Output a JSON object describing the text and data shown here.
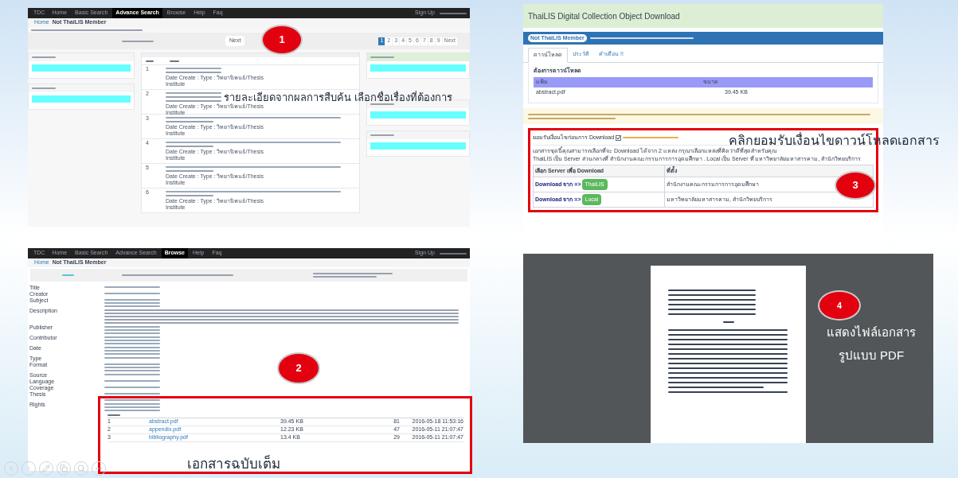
{
  "search_results": {
    "nav": {
      "brand": "TDC",
      "items": [
        {
          "label": "Home",
          "selected": false
        },
        {
          "label": "Basic Search",
          "selected": false
        },
        {
          "label": "Advance Search",
          "selected": true
        },
        {
          "label": "Browse",
          "selected": false
        },
        {
          "label": "Help",
          "selected": false
        },
        {
          "label": "Faq",
          "selected": false
        }
      ],
      "sign_up": "Sign Up"
    },
    "breadcrumb": [
      "Home",
      "Not ThaiLIS Member"
    ],
    "next_button": "Next",
    "pagination": [
      {
        "label": "1",
        "selected": true
      },
      {
        "label": "2",
        "selected": false
      },
      {
        "label": "3",
        "selected": false
      },
      {
        "label": "4",
        "selected": false
      },
      {
        "label": "5",
        "selected": false
      },
      {
        "label": "6",
        "selected": false
      },
      {
        "label": "7",
        "selected": false
      },
      {
        "label": "8",
        "selected": false
      },
      {
        "label": "9",
        "selected": false
      },
      {
        "label": "Next",
        "selected": false
      }
    ],
    "rows": [
      {
        "number": "1",
        "date_line": "Date Create : Type : วิทยานิพนธ์/Thesis",
        "institute": "Institute"
      },
      {
        "number": "2",
        "date_line": "Date Create : Type : วิทยานิพนธ์/Thesis",
        "institute": "Institute"
      },
      {
        "number": "3",
        "date_line": "Date Create : Type : วิทยานิพนธ์/Thesis",
        "institute": "Institute"
      },
      {
        "number": "4",
        "date_line": "Date Create : Type : วิทยานิพนธ์/Thesis",
        "institute": "Institute"
      },
      {
        "number": "5",
        "date_line": "Date Create : Type : วิทยานิพนธ์/Thesis",
        "institute": "Institute"
      },
      {
        "number": "6",
        "date_line": "Date Create : Type : วิทยานิพนธ์/Thesis",
        "institute": "Institute"
      }
    ],
    "callout": {
      "number": "1",
      "caption": "รายละเอียดจากผลการสืบค้น เลือกชื่อเรื่องที่ต้องการ"
    }
  },
  "record_detail": {
    "nav": {
      "brand": "TDC",
      "items": [
        {
          "label": "Home",
          "selected": false
        },
        {
          "label": "Basic Search",
          "selected": false
        },
        {
          "label": "Advance Search",
          "selected": false
        },
        {
          "label": "Browse",
          "selected": true
        },
        {
          "label": "Help",
          "selected": false
        },
        {
          "label": "Faq",
          "selected": false
        }
      ],
      "sign_up": "Sign Up"
    },
    "breadcrumb": [
      "Home",
      "Not ThaiLIS Member"
    ],
    "fields": [
      {
        "label": "Title",
        "kind": "short"
      },
      {
        "label": "Creator",
        "kind": "short"
      },
      {
        "label": "Subject",
        "kind": "list"
      },
      {
        "label": "Description",
        "kind": "long"
      },
      {
        "label": "Publisher",
        "kind": "list"
      },
      {
        "label": "Contributor",
        "kind": "list"
      },
      {
        "label": "Date",
        "kind": "list"
      },
      {
        "label": "Type",
        "kind": "short"
      },
      {
        "label": "Format",
        "kind": "list"
      },
      {
        "label": "Source",
        "kind": "short"
      },
      {
        "label": "Language",
        "kind": "short"
      },
      {
        "label": "Coverage",
        "kind": "short"
      },
      {
        "label": "Thesis",
        "kind": "list"
      },
      {
        "label": "Rights",
        "kind": "list"
      }
    ],
    "files": [
      {
        "number": "1",
        "name": "abstract.pdf",
        "size": "39.45 KB",
        "downloads": "81",
        "date": "2016-05-18 11:53:16"
      },
      {
        "number": "2",
        "name": "appendix.pdf",
        "size": "12.23 KB",
        "downloads": "47",
        "date": "2016-05-11 21:07:47"
      },
      {
        "number": "3",
        "name": "bibliography.pdf",
        "size": "13.4 KB",
        "downloads": "29",
        "date": "2016-05-11 21:07:47"
      }
    ],
    "callout": {
      "number": "2",
      "caption": "เอกสารฉบับเต็ม"
    }
  },
  "download_page": {
    "title": "ThaiLIS Digital Collection Object Download",
    "badge": "Not ThaiLIS Member",
    "tabs": [
      {
        "label": "ดาวน์โหลด",
        "selected": true
      },
      {
        "label": "ประวัติ",
        "selected": false
      },
      {
        "label": "คำเตือน !!",
        "selected": false
      }
    ],
    "want_download": "ต้องการดาวน์โหลด",
    "file_columns": [
      "แฟ้ม",
      "ขนาด"
    ],
    "file": {
      "name": "abstract.pdf",
      "size": "39.45 KB"
    },
    "accept_label": "ยอมรับเงื่อนไขก่อนการ Download",
    "accept_checked": true,
    "info": [
      "เอกสารชุดนี้คุณสามารถเลือกที่จะ Download ได้จาก 2 แหล่ง กรุณาเลือกแหล่งที่คิดว่าดีที่สุดสำหรับคุณ",
      "ThaiLIS เป็น Server ส่วนกลางที่ สำนักงานคณะกรรมการการอุดมศึกษา . Local เป็น Server ที่ มหาวิทยาลัยมหาสารคาม, สำนักวิทยบริการ"
    ],
    "server_columns": [
      "เลือก Server เพื่อ Download",
      "ที่ตั้ง"
    ],
    "servers": [
      {
        "prefix": "Download จาก =>",
        "button": "ThaiLIS",
        "location": "สำนักงานคณะกรรมการการอุดมศึกษา"
      },
      {
        "prefix": "Download จาก =>",
        "button": "Local",
        "location": "มหาวิทยาลัยมหาสารคาม, สำนักวิทยบริการ"
      }
    ],
    "callout": {
      "number": "3",
      "caption": "คลิกยอมรับเงื่อนไขดาวน์โหลดเอกสาร"
    }
  },
  "pdf_view": {
    "callout": {
      "number": "4",
      "caption": [
        "แสดงไฟล์เอกสาร",
        "รูปแบบ PDF"
      ]
    }
  }
}
